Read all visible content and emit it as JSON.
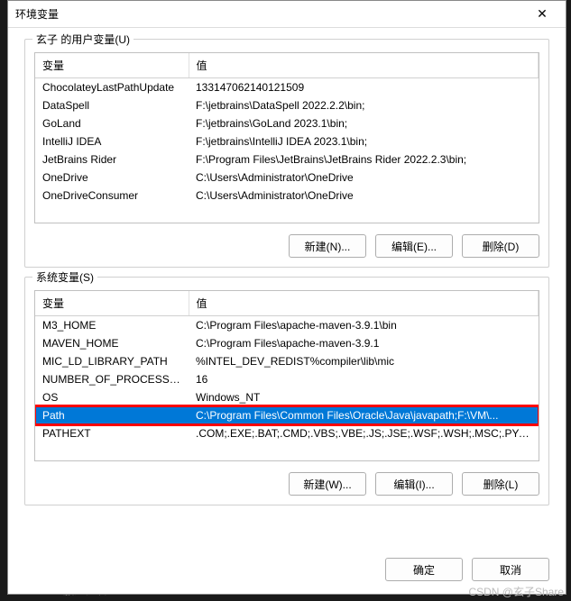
{
  "dialog": {
    "title": "环境变量",
    "close_glyph": "✕"
  },
  "user_group": {
    "label": "玄子 的用户变量(U)",
    "headers": {
      "name": "变量",
      "value": "值"
    },
    "rows": [
      {
        "name": "ChocolateyLastPathUpdate",
        "value": "133147062140121509"
      },
      {
        "name": "DataSpell",
        "value": "F:\\jetbrains\\DataSpell 2022.2.2\\bin;"
      },
      {
        "name": "GoLand",
        "value": "F:\\jetbrains\\GoLand 2023.1\\bin;"
      },
      {
        "name": "IntelliJ IDEA",
        "value": "F:\\jetbrains\\IntelliJ IDEA 2023.1\\bin;"
      },
      {
        "name": "JetBrains Rider",
        "value": "F:\\Program Files\\JetBrains\\JetBrains Rider 2022.2.3\\bin;"
      },
      {
        "name": "OneDrive",
        "value": "C:\\Users\\Administrator\\OneDrive"
      },
      {
        "name": "OneDriveConsumer",
        "value": "C:\\Users\\Administrator\\OneDrive"
      }
    ],
    "buttons": {
      "new": "新建(N)...",
      "edit": "编辑(E)...",
      "delete": "删除(D)"
    }
  },
  "system_group": {
    "label": "系统变量(S)",
    "headers": {
      "name": "变量",
      "value": "值"
    },
    "rows": [
      {
        "name": "M3_HOME",
        "value": "C:\\Program Files\\apache-maven-3.9.1\\bin"
      },
      {
        "name": "MAVEN_HOME",
        "value": "C:\\Program Files\\apache-maven-3.9.1"
      },
      {
        "name": "MIC_LD_LIBRARY_PATH",
        "value": "%INTEL_DEV_REDIST%compiler\\lib\\mic"
      },
      {
        "name": "NUMBER_OF_PROCESSORS",
        "value": "16"
      },
      {
        "name": "OS",
        "value": "Windows_NT"
      },
      {
        "name": "Path",
        "value": "C:\\Program Files\\Common Files\\Oracle\\Java\\javapath;F:\\VM\\...",
        "selected": true,
        "highlight": true
      },
      {
        "name": "PATHEXT",
        "value": ".COM;.EXE;.BAT;.CMD;.VBS;.VBE;.JS;.JSE;.WSF;.WSH;.MSC;.PY;.P..."
      }
    ],
    "buttons": {
      "new": "新建(W)...",
      "edit": "编辑(I)...",
      "delete": "删除(L)"
    }
  },
  "footer": {
    "ok": "确定",
    "cancel": "取消"
  },
  "watermark": "CSDN @玄子Share",
  "bg_text": "Microsoft 服务协议"
}
